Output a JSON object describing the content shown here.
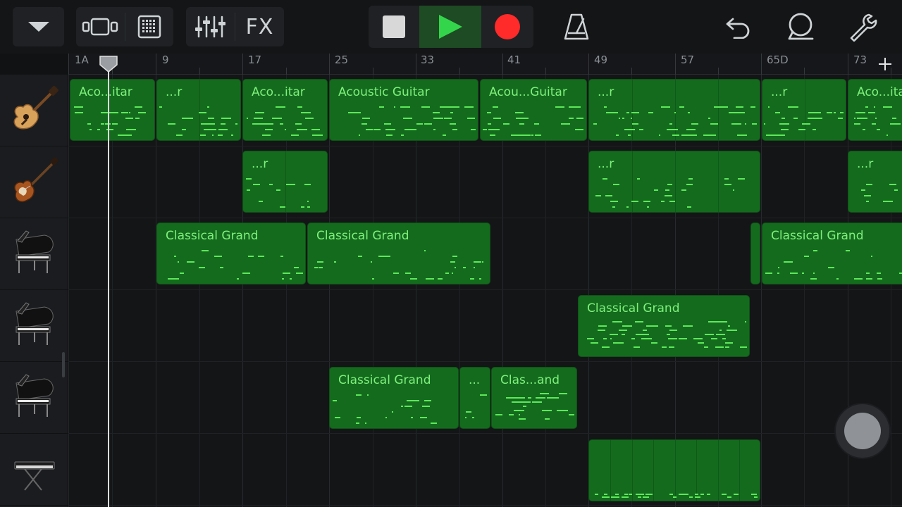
{
  "toolbar": {
    "fx_label": "FX",
    "icons": [
      "dropdown-icon",
      "view-toggle-icon",
      "grid-view-icon",
      "mixer-icon",
      "stop-icon",
      "play-icon",
      "record-icon",
      "metronome-icon",
      "undo-icon",
      "loop-icon",
      "settings-icon"
    ],
    "colors": {
      "play": "#33d64a",
      "record": "#ff2a2a",
      "stop": "#d8d8d8",
      "play_bg": "#1e4a24"
    }
  },
  "ruler": {
    "labels": [
      "1A",
      "9",
      "17",
      "25",
      "33",
      "41",
      "49",
      "57",
      "65D",
      "73"
    ],
    "add_label": "+"
  },
  "tracks": [
    {
      "icon": "acoustic-guitar-icon",
      "regions": [
        {
          "title": "Aco...itar"
        },
        {
          "title": "...r"
        },
        {
          "title": "Aco...itar"
        },
        {
          "title": "Acoustic Guitar"
        },
        {
          "title": "Acou...Guitar"
        },
        {
          "title": "...r"
        },
        {
          "title": "...r"
        },
        {
          "title": "Aco...ita"
        }
      ]
    },
    {
      "icon": "bass-guitar-icon",
      "regions": [
        {
          "title": "...r"
        },
        {
          "title": "...r"
        },
        {
          "title": "...r"
        }
      ]
    },
    {
      "icon": "grand-piano-icon",
      "regions": [
        {
          "title": "Classical Grand"
        },
        {
          "title": "Classical Grand"
        },
        {
          "title": ""
        },
        {
          "title": "Classical Grand"
        }
      ]
    },
    {
      "icon": "grand-piano-icon",
      "regions": [
        {
          "title": "Classical Grand"
        }
      ]
    },
    {
      "icon": "grand-piano-icon",
      "regions": [
        {
          "title": "Classical Grand"
        },
        {
          "title": "..."
        },
        {
          "title": "Clas...and"
        }
      ]
    },
    {
      "icon": "keyboard-synth-icon",
      "regions": [
        {
          "title": ""
        }
      ]
    }
  ],
  "colors": {
    "region_fill": "#146b1e",
    "region_title": "#7ef07a",
    "note": "#5ee85a",
    "background": "#141517"
  }
}
